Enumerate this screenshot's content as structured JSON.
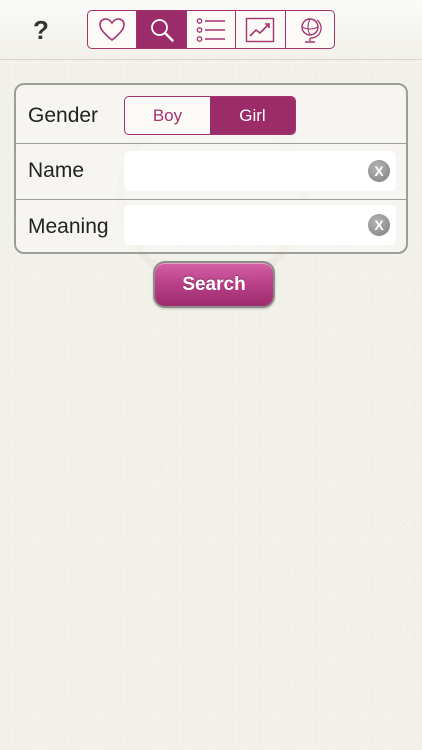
{
  "toolbar": {
    "help_label": "?",
    "tabs": [
      {
        "icon": "heart-icon",
        "active": false
      },
      {
        "icon": "search-icon",
        "active": true
      },
      {
        "icon": "list-icon",
        "active": false
      },
      {
        "icon": "trend-chart-icon",
        "active": false
      },
      {
        "icon": "globe-icon",
        "active": false
      }
    ]
  },
  "form": {
    "gender": {
      "label": "Gender",
      "options": [
        "Boy",
        "Girl"
      ],
      "selected": "Girl"
    },
    "name": {
      "label": "Name",
      "value": "",
      "placeholder": "",
      "clear_label": "X"
    },
    "meaning": {
      "label": "Meaning",
      "value": "",
      "placeholder": "",
      "clear_label": "X"
    }
  },
  "search_button": {
    "label": "Search"
  },
  "colors": {
    "accent": "#9b2c69",
    "button_gradient_top": "#d561a6",
    "button_gradient_bottom": "#9e2c6e",
    "background": "#f2f1ea"
  }
}
